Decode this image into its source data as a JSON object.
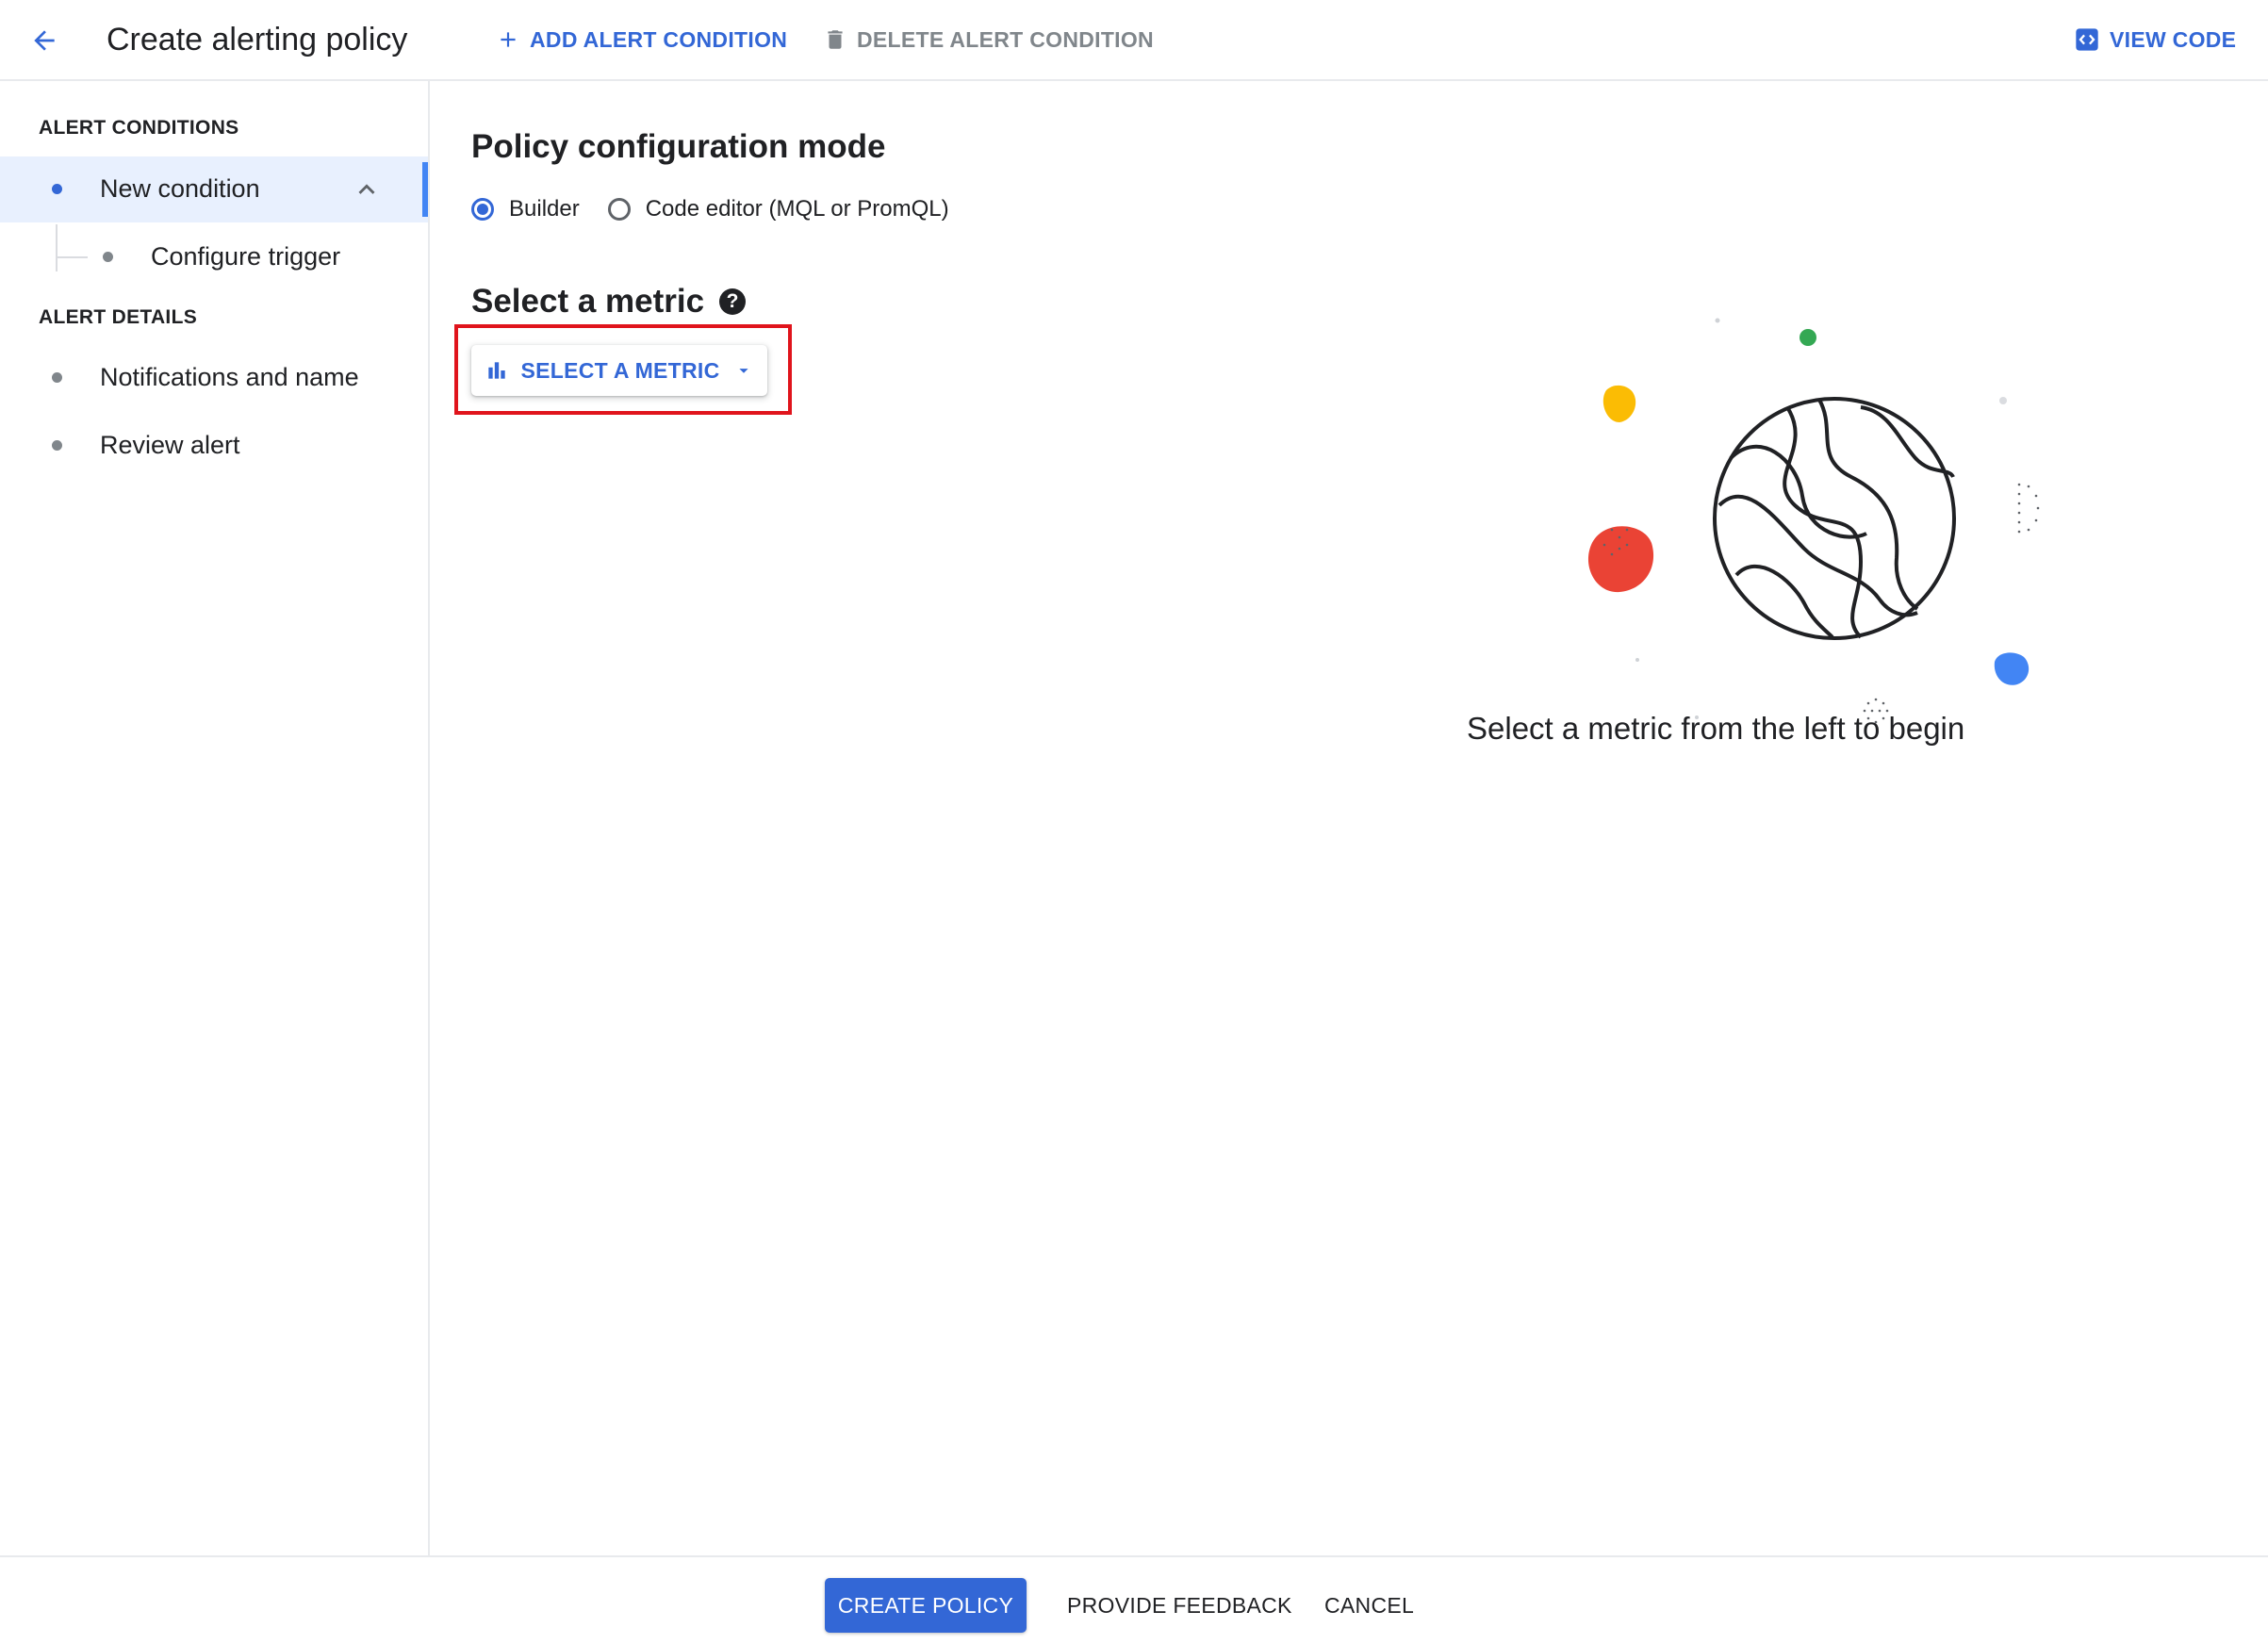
{
  "header": {
    "title": "Create alerting policy",
    "back_icon": "arrow-back-icon",
    "add_condition_label": "ADD ALERT CONDITION",
    "delete_condition_label": "DELETE ALERT CONDITION",
    "view_code_label": "VIEW CODE"
  },
  "sidebar": {
    "conditions_heading": "ALERT CONDITIONS",
    "new_condition_label": "New condition",
    "configure_trigger_label": "Configure trigger",
    "details_heading": "ALERT DETAILS",
    "notifications_label": "Notifications and name",
    "review_label": "Review alert"
  },
  "main": {
    "config_mode_title": "Policy configuration mode",
    "mode_options": [
      {
        "label": "Builder",
        "selected": true
      },
      {
        "label": "Code editor (MQL or PromQL)",
        "selected": false
      }
    ],
    "select_metric_title": "Select a metric",
    "help_icon_glyph": "?",
    "select_metric_button": "SELECT A METRIC",
    "empty_state_text": "Select a metric from the left to begin"
  },
  "footer": {
    "create_label": "CREATE POLICY",
    "feedback_label": "PROVIDE FEEDBACK",
    "cancel_label": "CANCEL"
  },
  "colors": {
    "accent": "#3367d6",
    "disabled": "#80868b",
    "highlight": "#e0141c",
    "active_bg": "#e8f0fe"
  }
}
